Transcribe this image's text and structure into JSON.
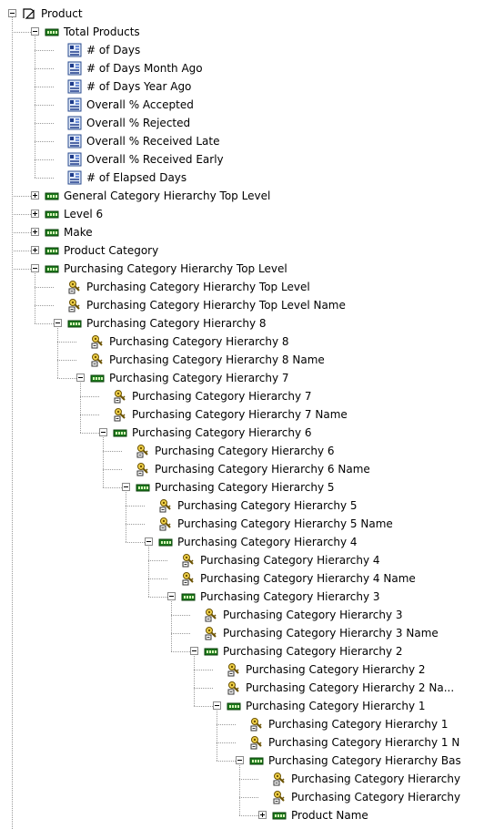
{
  "tree": {
    "root": {
      "label": "Product",
      "icon": "dimension-icon"
    },
    "nodes": [
      {
        "label": "Total Products",
        "icon": "hierarchy-level-icon",
        "depth": 1,
        "expander": "expanded"
      },
      {
        "label": "# of Days",
        "icon": "measure-icon",
        "depth": 2
      },
      {
        "label": "# of Days Month Ago",
        "icon": "measure-icon",
        "depth": 2
      },
      {
        "label": "# of Days Year Ago",
        "icon": "measure-icon",
        "depth": 2
      },
      {
        "label": "Overall % Accepted",
        "icon": "measure-icon",
        "depth": 2
      },
      {
        "label": "Overall % Rejected",
        "icon": "measure-icon",
        "depth": 2
      },
      {
        "label": "Overall % Received Late",
        "icon": "measure-icon",
        "depth": 2
      },
      {
        "label": "Overall % Received Early",
        "icon": "measure-icon",
        "depth": 2
      },
      {
        "label": "# of Elapsed Days",
        "icon": "measure-icon",
        "depth": 2
      },
      {
        "label": "General Category Hierarchy Top Level",
        "icon": "hierarchy-level-icon",
        "depth": 1,
        "expander": "collapsed"
      },
      {
        "label": "Level 6",
        "icon": "hierarchy-level-icon",
        "depth": 1,
        "expander": "collapsed"
      },
      {
        "label": "Make",
        "icon": "hierarchy-level-icon",
        "depth": 1,
        "expander": "collapsed"
      },
      {
        "label": "Product Category",
        "icon": "hierarchy-level-icon",
        "depth": 1,
        "expander": "collapsed"
      },
      {
        "label": "Purchasing Category Hierarchy Top Level",
        "icon": "hierarchy-level-icon",
        "depth": 1,
        "expander": "expanded"
      },
      {
        "label": "Purchasing Category Hierarchy Top Level",
        "icon": "key-attribute-icon",
        "depth": 2
      },
      {
        "label": "Purchasing Category Hierarchy Top Level Name",
        "icon": "key-attribute-icon",
        "depth": 2
      },
      {
        "label": "Purchasing Category Hierarchy 8",
        "icon": "hierarchy-level-icon",
        "depth": 2,
        "expander": "expanded"
      },
      {
        "label": "Purchasing Category Hierarchy 8",
        "icon": "key-attribute-icon",
        "depth": 3
      },
      {
        "label": "Purchasing Category Hierarchy 8 Name",
        "icon": "key-attribute-icon",
        "depth": 3
      },
      {
        "label": "Purchasing Category Hierarchy 7",
        "icon": "hierarchy-level-icon",
        "depth": 3,
        "expander": "expanded"
      },
      {
        "label": "Purchasing Category Hierarchy 7",
        "icon": "key-attribute-icon",
        "depth": 4
      },
      {
        "label": "Purchasing Category Hierarchy 7 Name",
        "icon": "key-attribute-icon",
        "depth": 4
      },
      {
        "label": "Purchasing Category Hierarchy 6",
        "icon": "hierarchy-level-icon",
        "depth": 4,
        "expander": "expanded"
      },
      {
        "label": "Purchasing Category Hierarchy 6",
        "icon": "key-attribute-icon",
        "depth": 5
      },
      {
        "label": "Purchasing Category Hierarchy 6 Name",
        "icon": "key-attribute-icon",
        "depth": 5
      },
      {
        "label": "Purchasing Category Hierarchy 5",
        "icon": "hierarchy-level-icon",
        "depth": 5,
        "expander": "expanded"
      },
      {
        "label": "Purchasing Category Hierarchy 5",
        "icon": "key-attribute-icon",
        "depth": 6
      },
      {
        "label": "Purchasing Category Hierarchy 5 Name",
        "icon": "key-attribute-icon",
        "depth": 6
      },
      {
        "label": "Purchasing Category Hierarchy 4",
        "icon": "hierarchy-level-icon",
        "depth": 6,
        "expander": "expanded"
      },
      {
        "label": "Purchasing Category Hierarchy 4",
        "icon": "key-attribute-icon",
        "depth": 7
      },
      {
        "label": "Purchasing Category Hierarchy 4 Name",
        "icon": "key-attribute-icon",
        "depth": 7
      },
      {
        "label": "Purchasing Category Hierarchy 3",
        "icon": "hierarchy-level-icon",
        "depth": 7,
        "expander": "expanded"
      },
      {
        "label": "Purchasing Category Hierarchy 3",
        "icon": "key-attribute-icon",
        "depth": 8
      },
      {
        "label": "Purchasing Category Hierarchy 3 Name",
        "icon": "key-attribute-icon",
        "depth": 8
      },
      {
        "label": "Purchasing Category Hierarchy 2",
        "icon": "hierarchy-level-icon",
        "depth": 8,
        "expander": "expanded"
      },
      {
        "label": "Purchasing Category Hierarchy 2",
        "icon": "key-attribute-icon",
        "depth": 9
      },
      {
        "label": "Purchasing Category Hierarchy 2 Na...",
        "icon": "key-attribute-icon",
        "depth": 9
      },
      {
        "label": "Purchasing Category Hierarchy 1",
        "icon": "hierarchy-level-icon",
        "depth": 9,
        "expander": "expanded"
      },
      {
        "label": "Purchasing Category Hierarchy 1",
        "icon": "key-attribute-icon",
        "depth": 10
      },
      {
        "label": "Purchasing Category Hierarchy 1 N",
        "icon": "key-attribute-icon",
        "depth": 10
      },
      {
        "label": "Purchasing Category Hierarchy Bas",
        "icon": "hierarchy-level-icon",
        "depth": 10,
        "expander": "expanded"
      },
      {
        "label": "Purchasing Category Hierarchy",
        "icon": "key-attribute-icon",
        "depth": 11
      },
      {
        "label": "Purchasing Category Hierarchy",
        "icon": "key-attribute-icon",
        "depth": 11
      },
      {
        "label": "Product Name",
        "icon": "hierarchy-level-icon",
        "depth": 11,
        "expander": "collapsed"
      }
    ]
  }
}
